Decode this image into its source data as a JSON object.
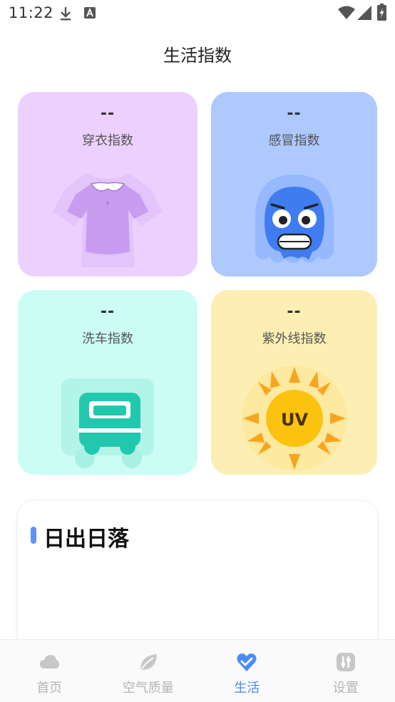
{
  "status_bar": {
    "time": "11:22"
  },
  "header": {
    "title": "生活指数"
  },
  "cards": [
    {
      "value": "--",
      "label": "穿衣指数",
      "icon": "shirt-icon"
    },
    {
      "value": "--",
      "label": "感冒指数",
      "icon": "cold-face-icon"
    },
    {
      "value": "--",
      "label": "洗车指数",
      "icon": "car-icon"
    },
    {
      "value": "--",
      "label": "紫外线指数",
      "icon": "sun-uv-icon",
      "badge": "UV"
    }
  ],
  "sunrise_panel": {
    "title": "日出日落"
  },
  "nav": {
    "items": [
      {
        "label": "首页",
        "icon": "cloud-icon",
        "active": false
      },
      {
        "label": "空气质量",
        "icon": "leaf-icon",
        "active": false
      },
      {
        "label": "生活",
        "icon": "heart-check-icon",
        "active": true
      },
      {
        "label": "设置",
        "icon": "sliders-icon",
        "active": false
      }
    ]
  },
  "colors": {
    "accent": "#4a8cf7",
    "card_dress": "#ecd1fe",
    "card_cold": "#adc9fd",
    "card_wash": "#cbfdf5",
    "card_uv": "#fdefb4"
  }
}
